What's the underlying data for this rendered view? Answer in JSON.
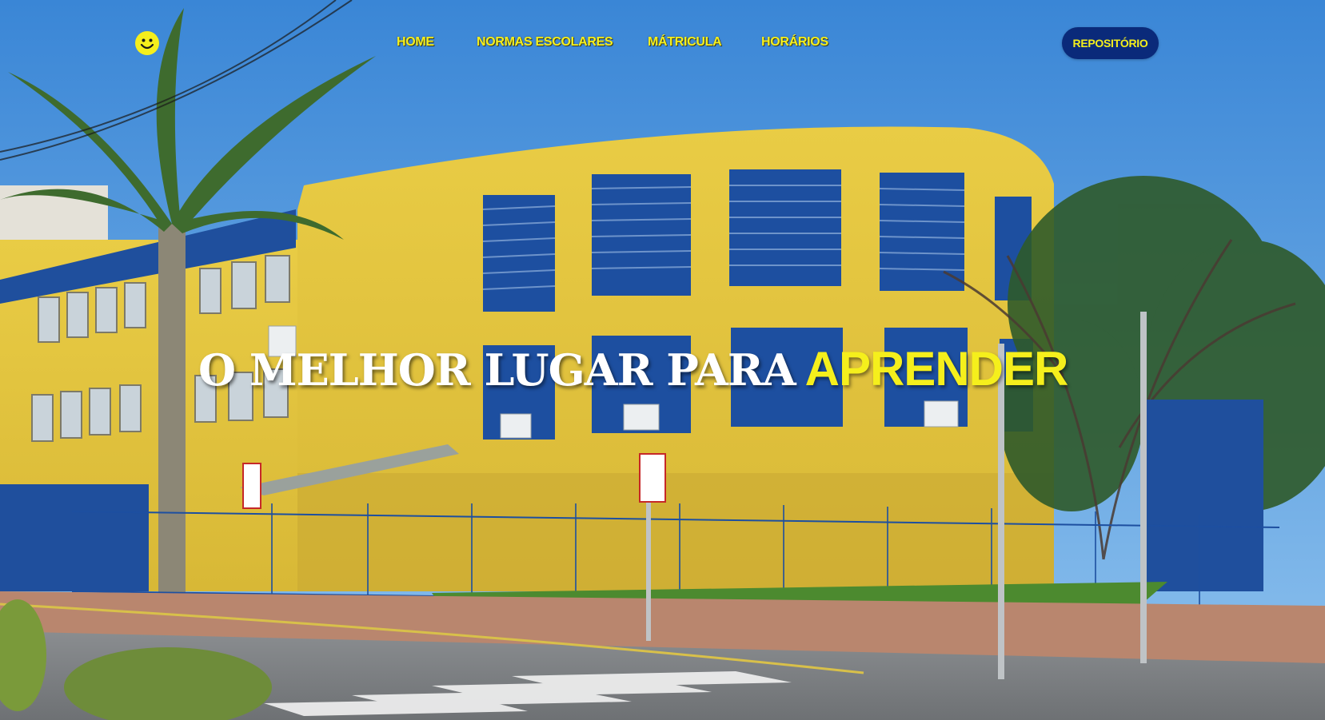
{
  "nav": {
    "logo_icon": "smiley-face-icon",
    "links": [
      {
        "label": "HOME"
      },
      {
        "label": "NORMAS ESCOLARES"
      },
      {
        "label": "MÁTRICULA"
      },
      {
        "label": "HORÁRIOS"
      }
    ],
    "cta_label": "REPOSITÓRIO"
  },
  "hero": {
    "headline_white": "O MELHOR LUGAR PARA",
    "headline_yellow": "APRENDER"
  },
  "colors": {
    "accent_yellow": "#f5ef1c",
    "button_navy": "#0a2a7a",
    "sky_blue": "#3d8ed9",
    "building_yellow": "#e7c83f",
    "building_blue": "#1d4fa0"
  }
}
